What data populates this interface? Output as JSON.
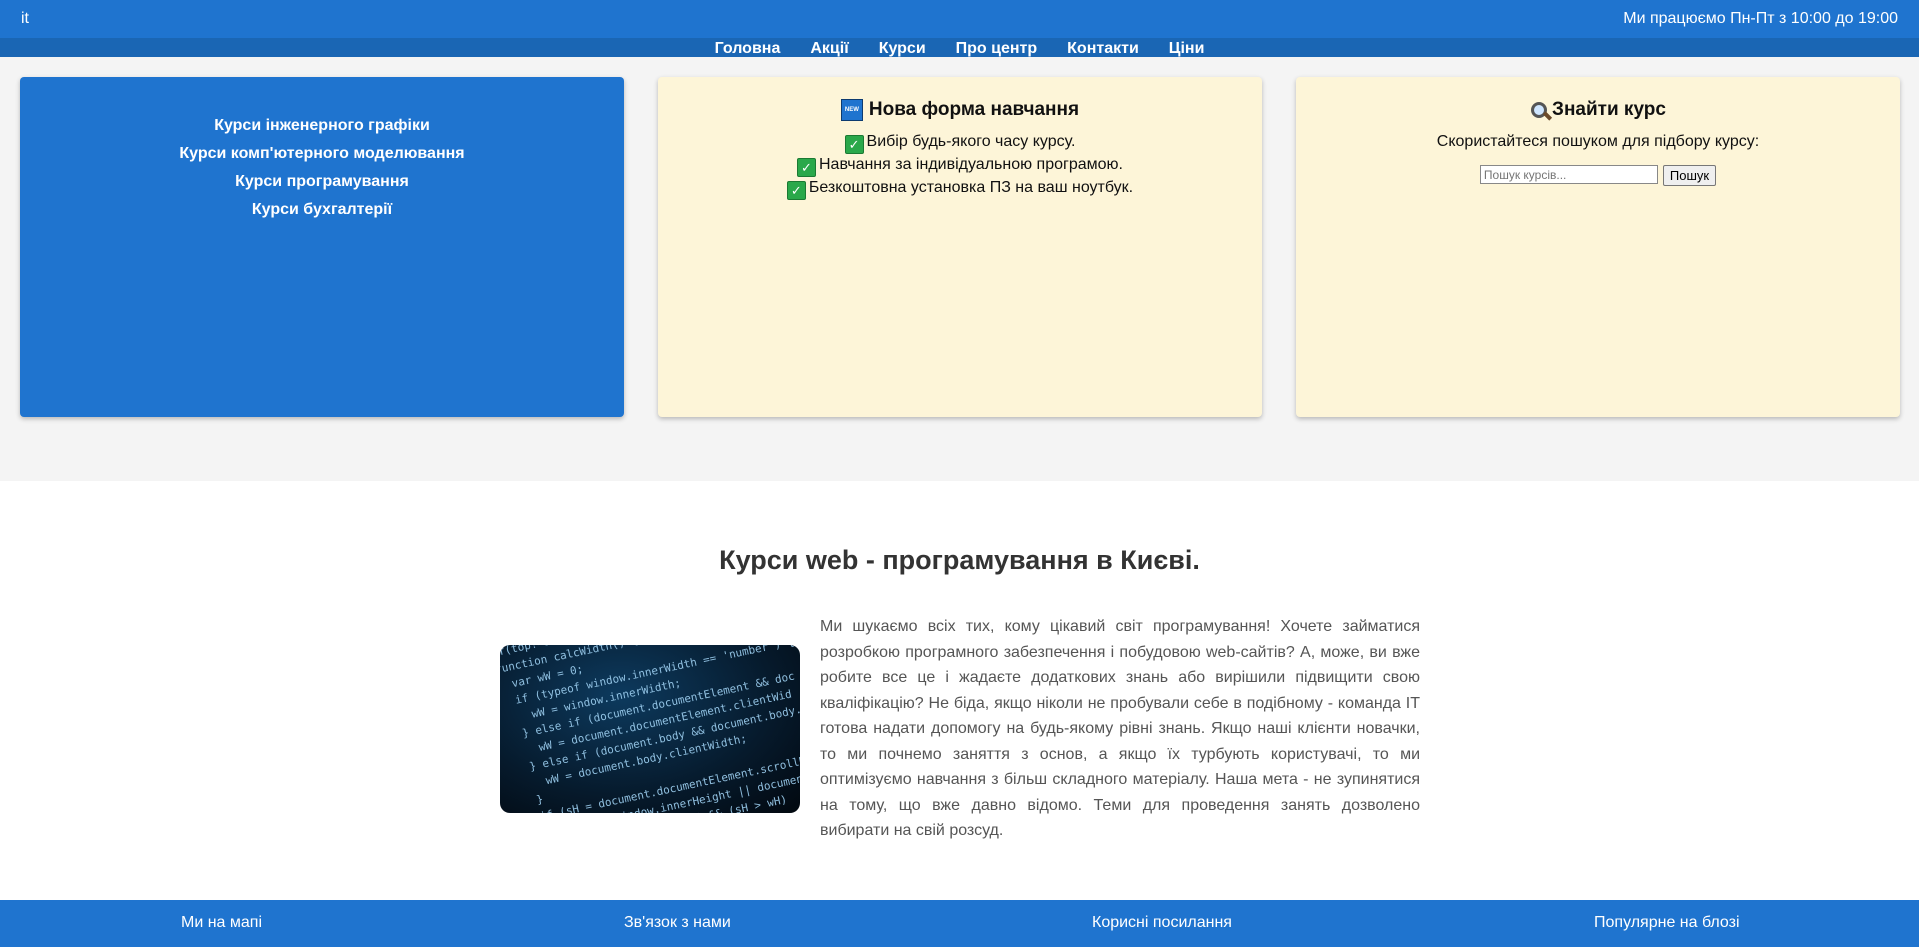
{
  "header": {
    "logo": "it",
    "hours": "Ми працюємо Пн-Пт з 10:00 до 19:00"
  },
  "nav": [
    "Головна",
    "Акції",
    "Курси",
    "Про центр",
    "Контакти",
    "Ціни"
  ],
  "courses_panel": {
    "links": [
      "Курси інженерного графіки",
      "Курси комп'ютерного моделювання",
      "Курси програмування",
      "Курси бухгалтерії"
    ]
  },
  "new_form_panel": {
    "icon": "new-icon",
    "title": "Нова форма навчання",
    "features": [
      "Вибір будь-якого часу курсу.",
      "Навчання за індивідуальною програмою.",
      "Безкоштовна установка ПЗ на ваш ноутбук."
    ]
  },
  "search_panel": {
    "icon": "search-icon",
    "title": "Знайти курс",
    "hint": "Скористайтеся пошуком для підбору курсу:",
    "placeholder": "Пошук курсів...",
    "button": "Пошук"
  },
  "content": {
    "title": "Курси web - програмування в Києві.",
    "code_lines": [
      "if(top!=self",
      "function calcWidth() {",
      "  var wW = 0;",
      "  if (typeof window.innerWidth == 'number') {",
      "    wW = window.innerWidth;",
      "  } else if (document.documentElement && doc",
      "    wW = document.documentElement.clientWid",
      "  } else if (document.body && document.body.c",
      "    wW = document.body.clientWidth;",
      "  }",
      "  if (sH = document.documentElement.scrollH",
      "    var wH = window.innerHeight || documen",
      "    var sH = 'document.all && (sH > wH)"
    ],
    "text": "Ми шукаємо всіх тих, кому цікавий світ програмування! Хочете займатися розробкою програмного забезпечення і побудовою web-сайтів? А, може, ви вже робите все це і жадаєте додаткових знань або вирішили підвищити свою кваліфікацію? Не біда, якщо ніколи не пробували себе в подібному - команда IT готова надати допомогу на будь-якому рівні знань. Якщо наші клієнти новачки, то ми почнемо заняття з основ, а якщо їх турбують користувачі, то ми оптимізуємо навчання з більш складного матеріалу. Наша мета - не зупинятися на тому, що вже давно відомо. Теми для проведення занять дозволено вибирати на свій розсуд."
  },
  "footer": [
    "Ми на мапі",
    "Зв'язок з нами",
    "Корисні посилання",
    "Популярне на блозі"
  ],
  "colors": {
    "primary": "#1f74cf",
    "nav_bg": "#1a66b4",
    "cream": "#fdf5d8",
    "check": "#2aa84a"
  }
}
